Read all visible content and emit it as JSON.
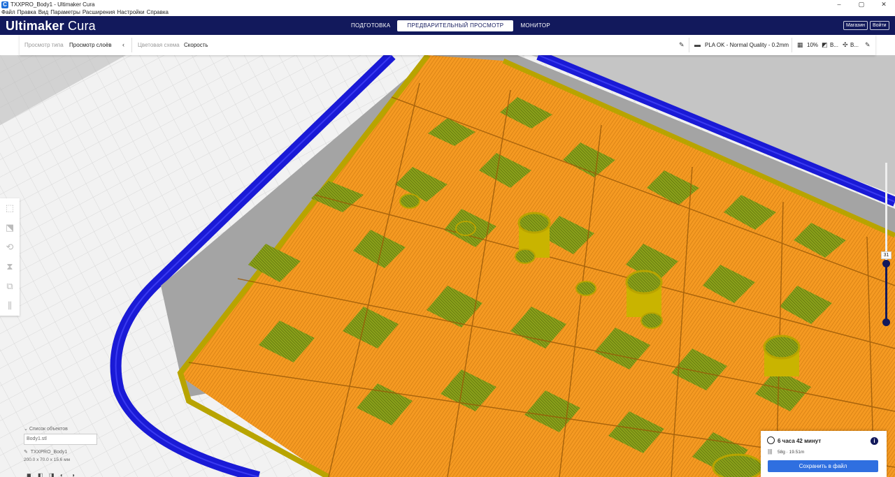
{
  "window": {
    "title": "TXXPRO_Body1 - Ultimaker Cura",
    "minimize": "–",
    "maximize": "▢",
    "close": "✕"
  },
  "menu": [
    "Файл",
    "Правка",
    "Вид",
    "Параметры",
    "Расширения",
    "Настройки",
    "Справка"
  ],
  "header": {
    "brand_bold": "Ultimaker",
    "brand_light": "Cura",
    "stages": [
      "ПОДГОТОВКА",
      "ПРЕДВАРИТЕЛЬНЫЙ ПРОСМОТР",
      "МОНИТОР"
    ],
    "active_stage": "ПРЕДВАРИТЕЛЬНЫЙ ПРОСМОТР",
    "marketplace": "Магазин",
    "sign_in": "Войти"
  },
  "toolbar": {
    "view_type_label": "Просмотр типа",
    "view_type_value": "Просмотр слоёв",
    "color_scheme_label": "Цветовая схема",
    "color_scheme_value": "Скорость",
    "profile": "PLA OK - Normal Quality - 0.2mm",
    "infill": "10%",
    "support": "В...",
    "adhesion": "В..."
  },
  "object_list": {
    "heading": "Список объектов",
    "file": "Body1.stl",
    "object_name": "TXXPRO_Body1",
    "dimensions": "200.0 x 70.0 x 15.6 мм"
  },
  "layer_slider": {
    "current_layer": "31"
  },
  "print_info": {
    "time": "6 часа 42 минут",
    "material": "58g · 19.51m",
    "save_button": "Сохранить в файл"
  },
  "colors": {
    "header_bg": "#12195c",
    "accent": "#2f6fe0",
    "model_orange": "#f5951e",
    "model_green": "#7a8f13",
    "skirt_blue": "#1a1ad6"
  }
}
